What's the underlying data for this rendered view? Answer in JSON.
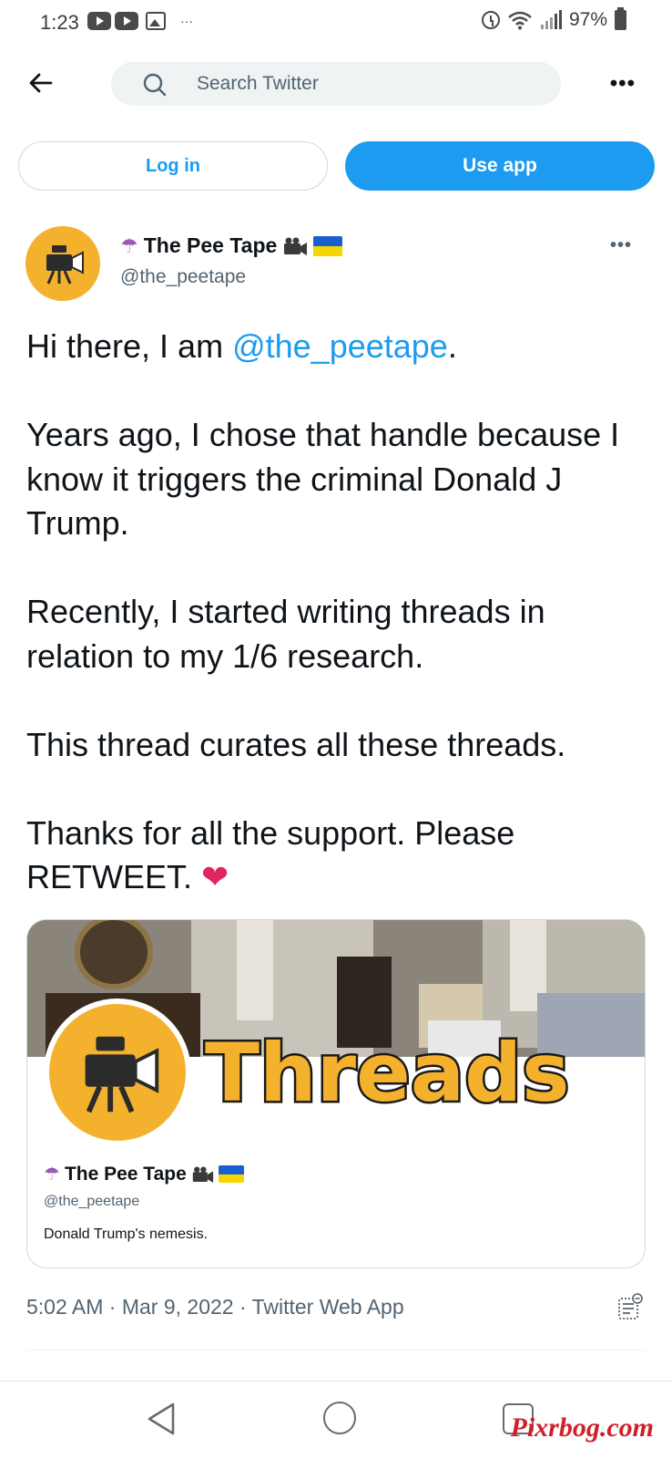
{
  "status_bar": {
    "time": "1:23",
    "battery": "97%"
  },
  "header": {
    "search_placeholder": "Search Twitter",
    "more_label": "•••"
  },
  "auth": {
    "login_label": "Log in",
    "use_app_label": "Use app"
  },
  "tweet": {
    "author_name": "The Pee Tape",
    "author_handle": "@the_peetape",
    "more_label": "•••",
    "paragraph_1_prefix": "Hi there, I am ",
    "paragraph_1_mention": "@the_peetape",
    "paragraph_1_suffix": ".",
    "paragraph_2": "Years ago, I chose that handle because I know it triggers the criminal Donald J Trump.",
    "paragraph_3": "Recently, I started writing threads in relation to my 1/6 research.",
    "paragraph_4": "This thread curates all these threads.",
    "paragraph_5": "Thanks for all the support. Please RETWEET.",
    "heart": "❤",
    "timestamp": "5:02 AM · Mar 9, 2022 · Twitter Web App"
  },
  "card": {
    "banner_text": "Threads",
    "name": "The Pee Tape",
    "handle": "@the_peetape",
    "bio": "Donald Trump's nemesis."
  },
  "watermark": "Pixrbog.com",
  "colors": {
    "accent": "#1d9bf0",
    "avatar_bg": "#f4b12e",
    "heart": "#e0245e",
    "muted": "#536471"
  }
}
